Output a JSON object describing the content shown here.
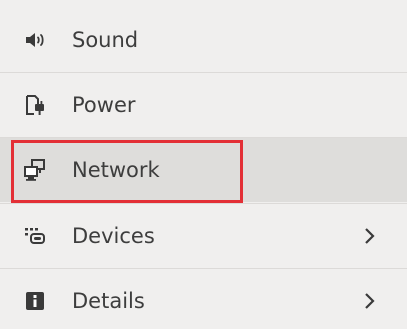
{
  "sidebar": {
    "items": [
      {
        "label": "Sound",
        "icon": "speaker-icon",
        "has_chevron": false
      },
      {
        "label": "Power",
        "icon": "power-plug-icon",
        "has_chevron": false
      },
      {
        "label": "Network",
        "icon": "network-computers-icon",
        "has_chevron": false,
        "selected": true
      },
      {
        "label": "Devices",
        "icon": "devices-icon",
        "has_chevron": true
      },
      {
        "label": "Details",
        "icon": "info-icon",
        "has_chevron": true
      }
    ]
  },
  "colors": {
    "sidebar_background": "#f0efee",
    "selected_background": "#dedddb",
    "highlight_border": "#e32f36",
    "text": "#3d3d3d",
    "icon": "#3a3a3a"
  }
}
